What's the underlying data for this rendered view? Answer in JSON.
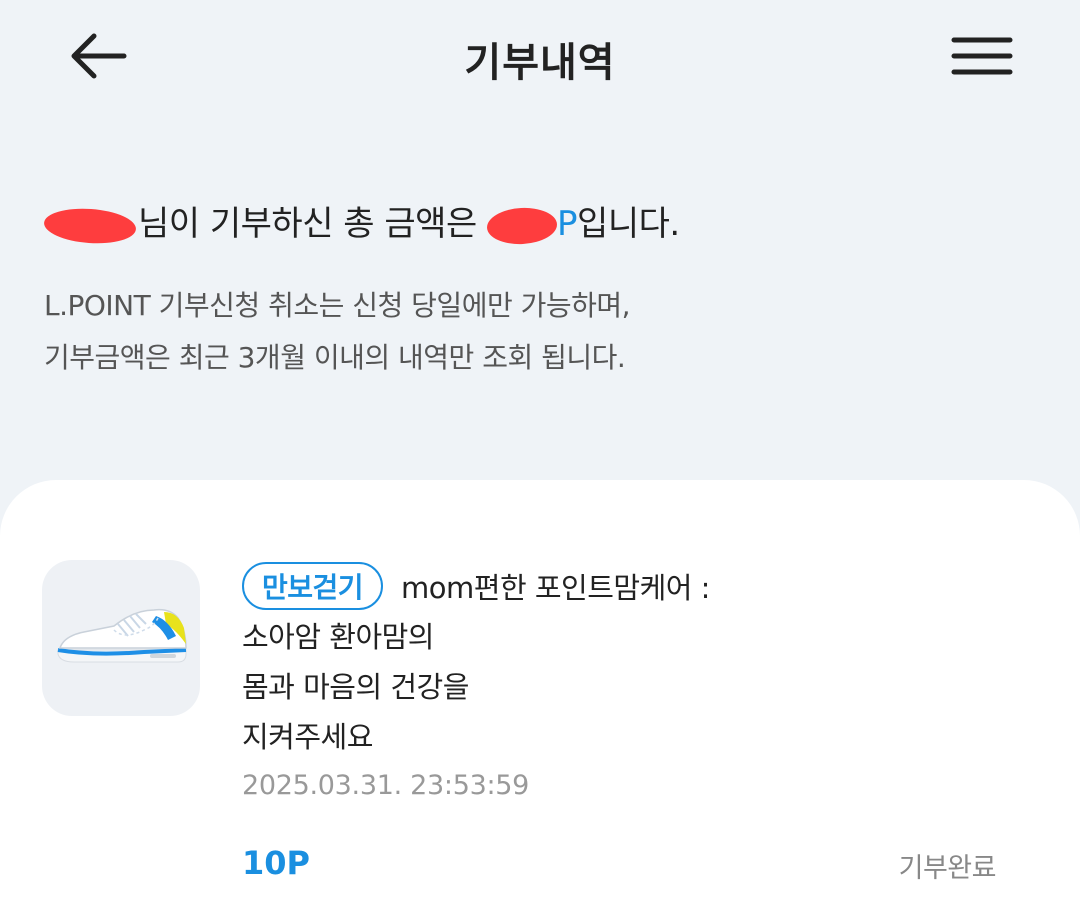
{
  "header": {
    "title": "기부내역",
    "back_icon": "arrow-left-icon",
    "menu_icon": "hamburger-menu-icon"
  },
  "summary": {
    "name_suffix": "님이 기부하신 총 금액은 ",
    "amount_unit": "P",
    "text_end": "입니다."
  },
  "notice": {
    "line1": "L.POINT 기부신청 취소는 신청 당일에만 가능하며,",
    "line2": "기부금액은 최근 3개월 이내의 내역만 조회 됩니다."
  },
  "donation": {
    "tag": "만보걷기",
    "organization": "mom편한 포인트맘케어 :",
    "description_lines": [
      "소아암 환아맘의",
      "몸과 마음의 건강을",
      "지켜주세요"
    ],
    "datetime": "2025.03.31. 23:53:59",
    "points": "10P",
    "status": "기부완료",
    "thumbnail_icon": "sneaker-icon"
  },
  "colors": {
    "background": "#eff3f7",
    "accent": "#1a8fe0",
    "card": "#ffffff"
  }
}
